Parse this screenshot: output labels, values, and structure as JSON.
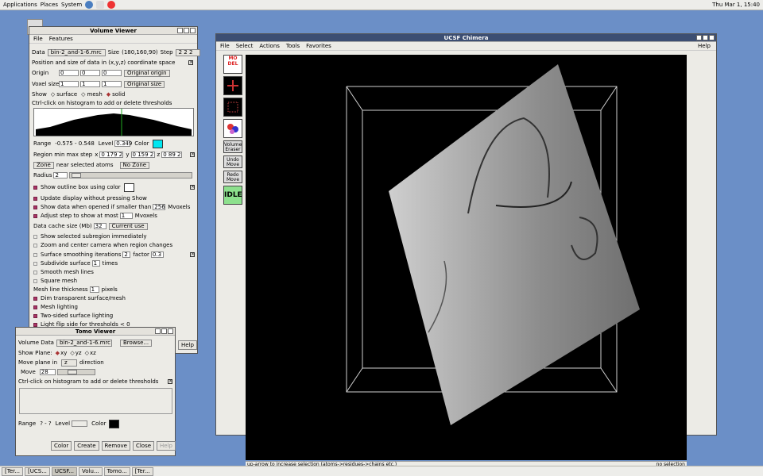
{
  "topbar": {
    "applications": "Applications",
    "places": "Places",
    "system": "System",
    "clock": "Thu Mar  1, 15:40"
  },
  "taskbar": [
    "[Ter...",
    "[UCS...",
    "UCSF...",
    "Volu...",
    "Tomo...",
    "[Ter..."
  ],
  "volume_viewer": {
    "title": "Volume Viewer",
    "menus": [
      "File",
      "Features"
    ],
    "data_label": "Data",
    "data_value": "bin-2_and-1-6.mrc",
    "size_label": "Size",
    "size_value": "(180,160,90)",
    "step_label": "Step",
    "step_value": "2 2 2",
    "position_heading": "Position and size of data in (x,y,z) coordinate space",
    "origin_label": "Origin",
    "origin_values": [
      "0",
      "0",
      "0"
    ],
    "original_origin": "Original origin",
    "voxel_label": "Voxel size",
    "voxel_values": [
      "1",
      "1",
      "1"
    ],
    "original_size": "Original size",
    "show_label": "Show",
    "show_surface": "surface",
    "show_mesh": "mesh",
    "show_solid": "solid",
    "ctrl_click": "Ctrl-click on histogram to add or delete thresholds",
    "range_label": "Range",
    "range_value": "-0.575 - 0.548",
    "level_label": "Level",
    "level_value": "0.349",
    "color_label": "Color",
    "region_label": "Region min max step",
    "x_label": "x",
    "x_value": "0 179 2",
    "y_label": "y",
    "y_value": "0 159 2",
    "z_label": "z",
    "z_value": "0 89 2",
    "zone_btn": "Zone",
    "near_atoms": "near selected atoms",
    "no_zone": "No Zone",
    "radius_label": "Radius",
    "radius_value": "2",
    "outline_box": "Show outline box using color",
    "update_display": "Update display without pressing Show",
    "show_data_when": "Show data when opened if smaller than",
    "show_data_val": "256",
    "mvoxels": "Mvoxels",
    "adjust_step": "Adjust step to show at most",
    "adjust_val": "1",
    "mvoxels2": "Mvoxels",
    "cache_label": "Data cache size (Mb)",
    "cache_val": "32",
    "current_use": "Current use",
    "show_subregion": "Show selected subregion immediately",
    "zoom_center": "Zoom and center camera when region changes",
    "surface_smoothing": "Surface smoothing iterations",
    "smooth_iter": "2",
    "factor_label": "factor",
    "factor_val": "0.3",
    "subdivide": "Subdivide surface",
    "subdivide_val": "1",
    "times": "times",
    "smooth_mesh": "Smooth mesh lines",
    "square_mesh": "Square mesh",
    "mesh_thickness": "Mesh line thickness",
    "thickness_val": "1",
    "pixels": "pixels",
    "dim_transparent": "Dim transparent surface/mesh",
    "mesh_lighting": "Mesh lighting",
    "two_sided": "Two-sided surface lighting",
    "light_flip": "Light flip side for thresholds < 0",
    "help": "Help"
  },
  "tomo_viewer": {
    "title": "Tomo Viewer",
    "volume_label": "Volume Data",
    "volume_value": "bin-2_and-1-6.mrc",
    "browse": "Browse...",
    "show_plane": "Show Plane:",
    "plane_xy": "xy",
    "plane_yz": "yz",
    "plane_xz": "xz",
    "move_plane": "Move plane in",
    "axis": "z",
    "direction": "direction",
    "move_label": "Move",
    "move_val": "28",
    "ctrl_click": "Ctrl-click on histogram to add or delete thresholds",
    "range_label": "Range",
    "range_value": "? - ?",
    "level_label": "Level",
    "color_label": "Color",
    "buttons": [
      "Color",
      "Create",
      "Remove",
      "Close",
      "Help"
    ]
  },
  "chimera": {
    "title": "UCSF Chimera",
    "menus": [
      "File",
      "Select",
      "Actions",
      "Tools",
      "Favorites"
    ],
    "help": "Help",
    "volume_eraser": "Volume Eraser",
    "undo_move": "Undo Move",
    "redo_move": "Redo Move",
    "idle": "IDLE",
    "status": "up-arrow to increase selection (atoms->residues->chains etc.)",
    "no_selection": "no selection"
  }
}
